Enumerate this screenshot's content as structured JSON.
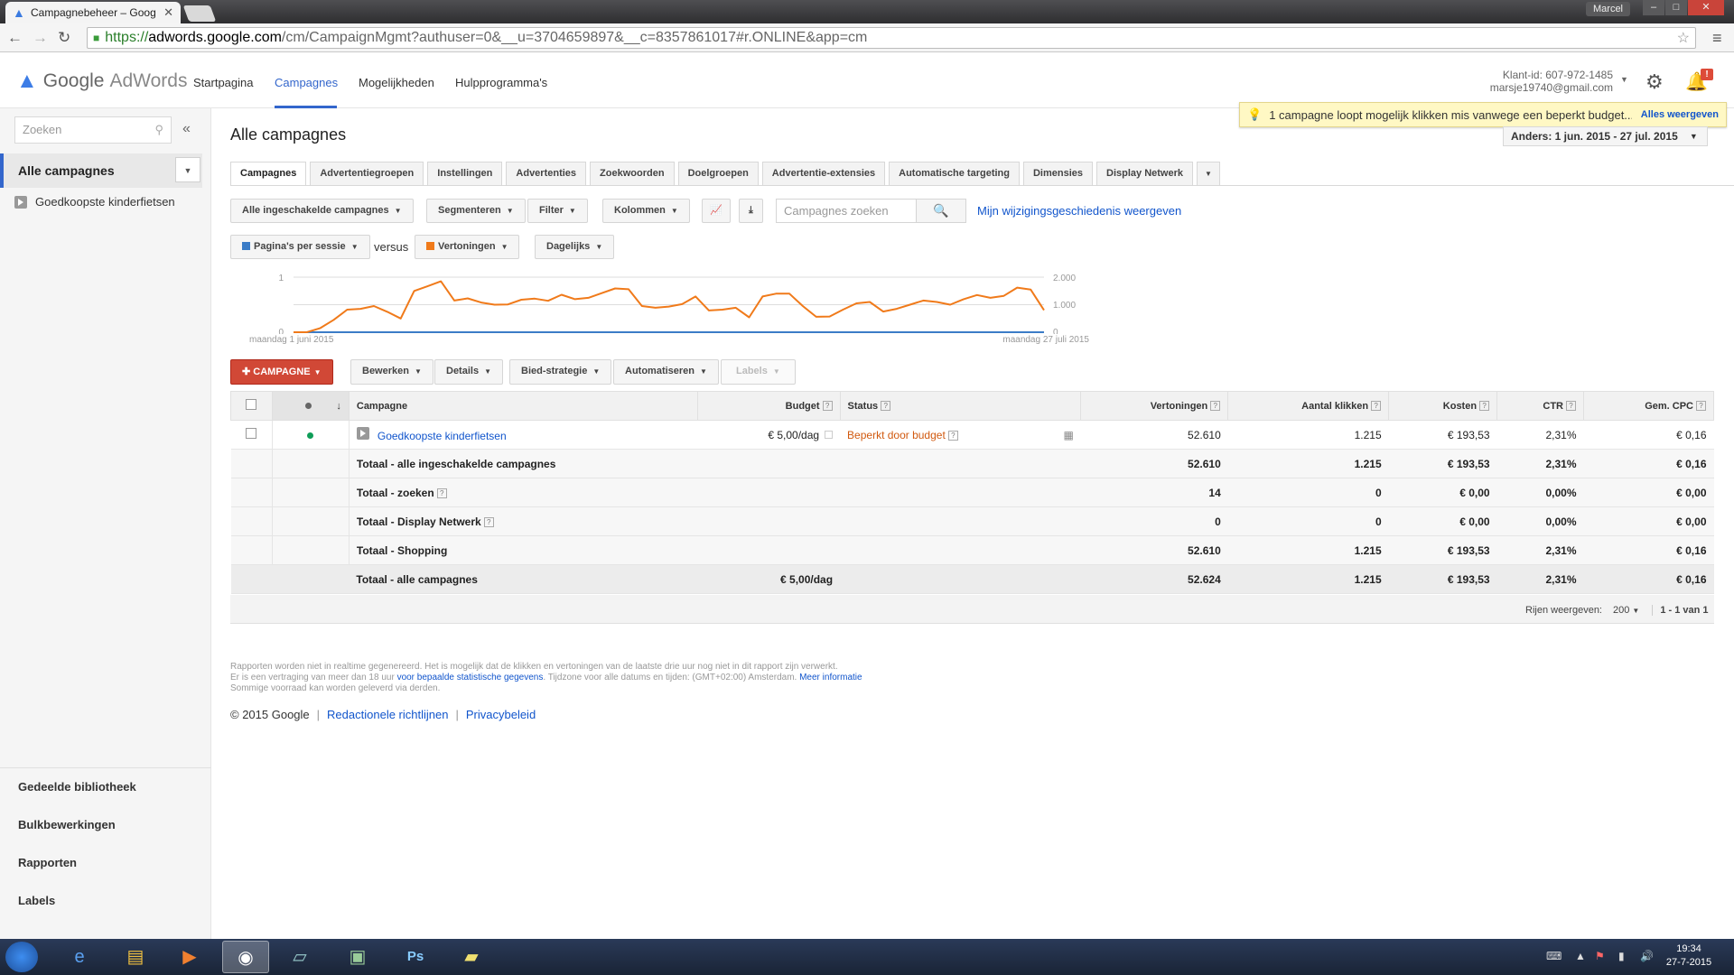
{
  "browser": {
    "tab_title": "Campagnebeheer – Goog",
    "user_badge": "Marcel",
    "url_scheme": "https://",
    "url_host": "adwords.google.com",
    "url_rest": "/cm/CampaignMgmt?authuser=0&__u=3704659897&__c=8357861017#r.ONLINE&app=cm"
  },
  "header": {
    "logo_google": "Google",
    "logo_adwords": "AdWords",
    "nav": [
      "Startpagina",
      "Campagnes",
      "Mogelijkheden",
      "Hulpprogramma's"
    ],
    "active_nav": "Campagnes",
    "client_id": "Klant-id: 607-972-1485",
    "email": "marsje19740@gmail.com",
    "notification_count": "!",
    "notification": "1 campagne loopt mogelijk klikken mis vanwege een beperkt budget...",
    "notification_link": "Alles weergeven"
  },
  "sidebar": {
    "search_placeholder": "Zoeken",
    "all_campaigns": "Alle campagnes",
    "campaigns": [
      "Goedkoopste kinderfietsen"
    ],
    "bottom": [
      "Gedeelde bibliotheek",
      "Bulkbewerkingen",
      "Rapporten",
      "Labels"
    ]
  },
  "main": {
    "title": "Alle campagnes",
    "date_range": "Anders: 1 jun. 2015 - 27 jul. 2015",
    "tabs": [
      "Campagnes",
      "Advertentiegroepen",
      "Instellingen",
      "Advertenties",
      "Zoekwoorden",
      "Doelgroepen",
      "Advertentie-extensies",
      "Automatische targeting",
      "Dimensies",
      "Display Netwerk"
    ],
    "filters": [
      "Alle ingeschakelde campagnes",
      "Segmenteren",
      "Filter",
      "Kolommen"
    ],
    "search_placeholder": "Campagnes zoeken",
    "history_link": "Mijn wijzigingsgeschiedenis weergeven",
    "metric1": "Pagina's per sessie",
    "versus": "versus",
    "metric2": "Vertoningen",
    "granularity": "Dagelijks",
    "add_campaign": "CAMPAGNE",
    "actions": [
      "Bewerken",
      "Details",
      "Bied-strategie",
      "Automatiseren",
      "Labels"
    ]
  },
  "chart_data": {
    "type": "line",
    "x_start_label": "maandag 1 juni 2015",
    "x_end_label": "maandag 27 juli 2015",
    "y_left_ticks": [
      "1",
      "0"
    ],
    "y_right_ticks": [
      "2.000",
      "1.000",
      "0"
    ],
    "y_left_lim": [
      0,
      1
    ],
    "y_right_lim": [
      0,
      2000
    ],
    "colors": {
      "metric1": "#3b7cc7",
      "metric2": "#f07a1a"
    },
    "series": [
      {
        "values": [
          0,
          0,
          0,
          0,
          0,
          0,
          0,
          0,
          0,
          0,
          0,
          0,
          0,
          0,
          0,
          0,
          0,
          0,
          0,
          0,
          0,
          0,
          0,
          0,
          0,
          0,
          0,
          0,
          0,
          0,
          0,
          0,
          0,
          0,
          0,
          0,
          0,
          0,
          0,
          0,
          0,
          0,
          0,
          0,
          0,
          0,
          0,
          0,
          0,
          0,
          0,
          0,
          0,
          0,
          0,
          0,
          0
        ]
      },
      {
        "values": [
          0,
          0,
          150,
          450,
          820,
          850,
          950,
          740,
          500,
          1500,
          1670,
          1850,
          1150,
          1230,
          1080,
          1000,
          1010,
          1180,
          1220,
          1140,
          1360,
          1200,
          1250,
          1420,
          1590,
          1560,
          950,
          890,
          930,
          1020,
          1300,
          790,
          820,
          890,
          540,
          1300,
          1400,
          1400,
          950,
          560,
          570,
          820,
          1050,
          1100,
          750,
          850,
          1000,
          1150,
          1100,
          1000,
          1200,
          1350,
          1250,
          1320,
          1620,
          1550,
          800
        ]
      }
    ]
  },
  "table": {
    "headers": {
      "campaign": "Campagne",
      "budget": "Budget",
      "status": "Status",
      "impressions": "Vertoningen",
      "clicks": "Aantal klikken",
      "cost": "Kosten",
      "ctr": "CTR",
      "cpc": "Gem. CPC"
    },
    "rows": [
      {
        "campaign": "Goedkoopste kinderfietsen",
        "budget": "€ 5,00/dag",
        "status": "Beperkt door budget",
        "impressions": "52.610",
        "clicks": "1.215",
        "cost": "€ 193,53",
        "ctr": "2,31%",
        "cpc": "€ 0,16"
      }
    ],
    "totals": [
      {
        "label": "Totaal - alle ingeschakelde campagnes",
        "impressions": "52.610",
        "clicks": "1.215",
        "cost": "€ 193,53",
        "ctr": "2,31%",
        "cpc": "€ 0,16"
      },
      {
        "label": "Totaal - zoeken",
        "impressions": "14",
        "clicks": "0",
        "cost": "€ 0,00",
        "ctr": "0,00%",
        "cpc": "€ 0,00"
      },
      {
        "label": "Totaal - Display Netwerk",
        "impressions": "0",
        "clicks": "0",
        "cost": "€ 0,00",
        "ctr": "0,00%",
        "cpc": "€ 0,00"
      },
      {
        "label": "Totaal - Shopping",
        "impressions": "52.610",
        "clicks": "1.215",
        "cost": "€ 193,53",
        "ctr": "2,31%",
        "cpc": "€ 0,16"
      }
    ],
    "grand": {
      "label": "Totaal - alle campagnes",
      "budget": "€ 5,00/dag",
      "impressions": "52.624",
      "clicks": "1.215",
      "cost": "€ 193,53",
      "ctr": "2,31%",
      "cpc": "€ 0,16"
    },
    "rows_label": "Rijen weergeven:",
    "rows_value": "200",
    "range": "1 - 1 van 1"
  },
  "footer": {
    "line1": "Rapporten worden niet in realtime gegenereerd. Het is mogelijk dat de klikken en vertoningen van de laatste drie uur nog niet in dit rapport zijn verwerkt.",
    "line2_a": "Er is een vertraging van meer dan 18 uur",
    "line2_link": "voor bepaalde statistische gegevens",
    "line2_b": ". Tijdzone voor alle datums en tijden: (GMT+02:00) Amsterdam.",
    "line2_link2": "Meer informatie",
    "line3": "Sommige voorraad kan worden geleverd via derden.",
    "copyright": "© 2015 Google",
    "link1": "Redactionele richtlijnen",
    "link2": "Privacybeleid"
  },
  "taskbar": {
    "time": "19:34",
    "date": "27-7-2015"
  }
}
